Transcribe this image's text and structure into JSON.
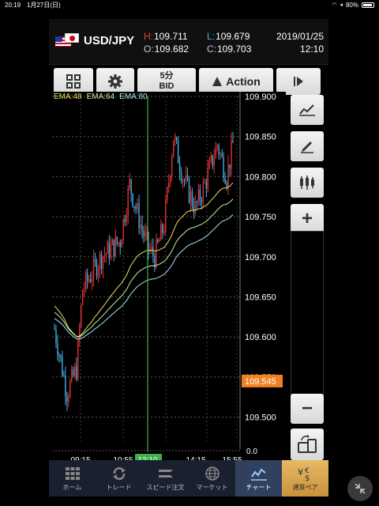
{
  "status": {
    "time": "20:19",
    "date": "1月27日(日)",
    "battery": "80%"
  },
  "header": {
    "pair": "USD/JPY",
    "high_label": "H:",
    "high": "109.711",
    "low_label": "L:",
    "low": "109.679",
    "open_label": "O:",
    "open": "109.682",
    "close_label": "C:",
    "close": "109.703",
    "date": "2019/01/25",
    "time": "12:10"
  },
  "toolbar": {
    "period_top": "5分",
    "period_bottom": "BID",
    "action_label": "Action"
  },
  "ema": [
    {
      "label": "EMA:48",
      "color": "#f0e060"
    },
    {
      "label": "EMA:64",
      "color": "#c8f0a0"
    },
    {
      "label": "EMA:80",
      "color": "#a0e8f0"
    }
  ],
  "chart_data": {
    "type": "candlestick",
    "price_ticks": [
      "109.900",
      "109.850",
      "109.800",
      "109.750",
      "109.700",
      "109.650",
      "109.600",
      "109.550",
      "109.500"
    ],
    "time_ticks": [
      "09:15",
      "10:55",
      "12:10",
      "14:15",
      "15:55"
    ],
    "current_price": "109.545",
    "current_price_color": "#f08020",
    "bull_color": "#e83030",
    "bear_color": "#40b0e8",
    "ylim": [
      109.47,
      109.9
    ],
    "extra_tick": "0.0"
  },
  "side_tools": {
    "zoom_in": "+",
    "zoom_out": "−"
  },
  "nav": {
    "items": [
      {
        "label": "ホーム"
      },
      {
        "label": "トレード"
      },
      {
        "label": "スピード注文"
      },
      {
        "label": "マーケット"
      },
      {
        "label": "チャート"
      },
      {
        "label": "通貨ペア"
      }
    ]
  }
}
